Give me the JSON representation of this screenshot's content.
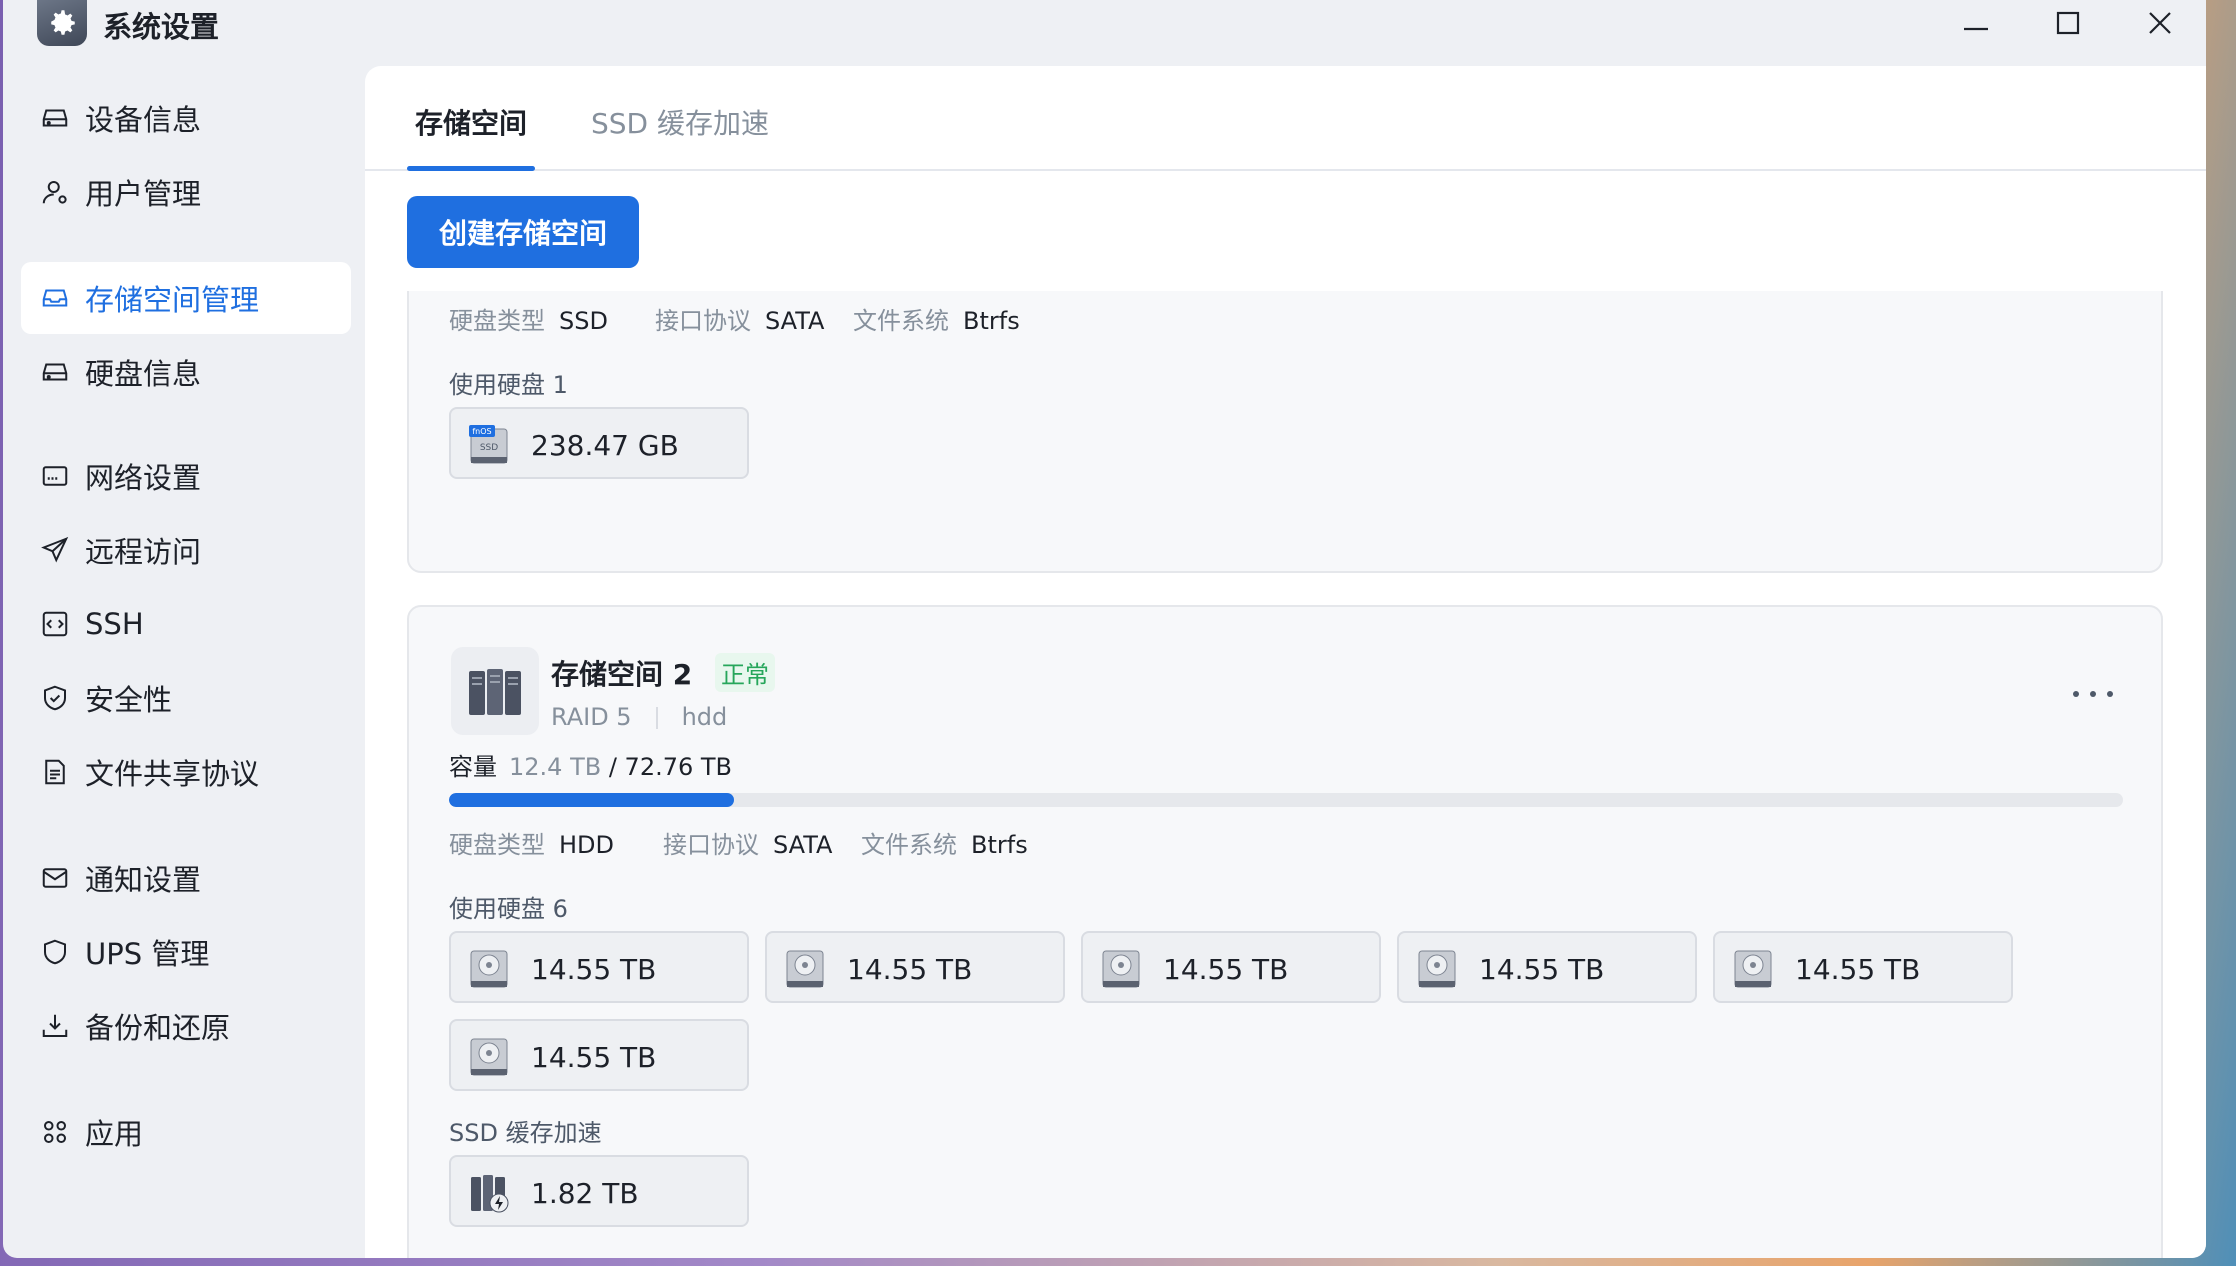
{
  "window": {
    "title": "系统设置"
  },
  "sidebar": {
    "items": [
      {
        "label": "设备信息",
        "icon": "device-icon"
      },
      {
        "label": "用户管理",
        "icon": "user-icon"
      },
      {
        "label": "存储空间管理",
        "icon": "storage-icon",
        "active": true
      },
      {
        "label": "硬盘信息",
        "icon": "disk-icon"
      },
      {
        "label": "网络设置",
        "icon": "network-icon"
      },
      {
        "label": "远程访问",
        "icon": "send-icon"
      },
      {
        "label": "SSH",
        "icon": "ssh-icon"
      },
      {
        "label": "安全性",
        "icon": "shield-icon"
      },
      {
        "label": "文件共享协议",
        "icon": "file-icon"
      },
      {
        "label": "通知设置",
        "icon": "mail-icon"
      },
      {
        "label": "UPS 管理",
        "icon": "ups-shield-icon"
      },
      {
        "label": "备份和还原",
        "icon": "backup-icon"
      },
      {
        "label": "应用",
        "icon": "apps-icon"
      }
    ]
  },
  "tabs": [
    {
      "label": "存储空间",
      "active": true
    },
    {
      "label": "SSD 缓存加速",
      "active": false
    }
  ],
  "toolbar": {
    "create_label": "创建存储空间"
  },
  "pool1": {
    "disk_type_label": "硬盘类型",
    "disk_type": "SSD",
    "interface_label": "接口协议",
    "interface": "SATA",
    "fs_label": "文件系统",
    "fs": "Btrfs",
    "used_disks_label": "使用硬盘 1",
    "disks": [
      {
        "size": "238.47 GB",
        "badge": "fnOS",
        "kind": "SSD"
      }
    ]
  },
  "pool2": {
    "title": "存储空间 2",
    "status": "正常",
    "raid": "RAID 5",
    "tag": "hdd",
    "capacity_label": "容量",
    "used": "12.4 TB",
    "total": "/ 72.76 TB",
    "usage_fraction": 0.17,
    "disk_type_label": "硬盘类型",
    "disk_type": "HDD",
    "interface_label": "接口协议",
    "interface": "SATA",
    "fs_label": "文件系统",
    "fs": "Btrfs",
    "used_disks_label": "使用硬盘 6",
    "disks": [
      {
        "size": "14.55 TB"
      },
      {
        "size": "14.55 TB"
      },
      {
        "size": "14.55 TB"
      },
      {
        "size": "14.55 TB"
      },
      {
        "size": "14.55 TB"
      },
      {
        "size": "14.55 TB"
      }
    ],
    "ssd_cache_label": "SSD 缓存加速",
    "ssd_cache": {
      "size": "1.82 TB"
    }
  },
  "colors": {
    "accent": "#1f6fe0",
    "status_ok": "#26a65b"
  }
}
